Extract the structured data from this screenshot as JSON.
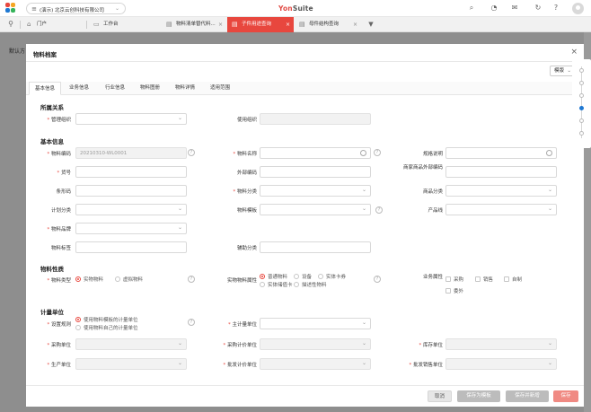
{
  "topbar": {
    "org": "(演示) 北京云创科技有限公司",
    "brand_a": "Yon",
    "brand_b": "Suite"
  },
  "tabs": [
    {
      "label": "门户"
    },
    {
      "label": "工作台"
    },
    {
      "label": "物料清单替代料..."
    },
    {
      "label": "子件用途查询"
    },
    {
      "label": "母件结构查询"
    }
  ],
  "background": {
    "label": "默认方"
  },
  "modal": {
    "title": "物料档案",
    "template_label": "模版",
    "tabs": [
      "基本信息",
      "业务信息",
      "行业信息",
      "物料图册",
      "物料详情",
      "适用范围"
    ],
    "sections": {
      "ownership": "所属关系",
      "basic": "基本信息",
      "nature": "物料性质",
      "unit": "计量单位"
    },
    "fields": {
      "mgmt_org": "管理组织",
      "use_org": "使用组织",
      "code": "物料编码",
      "code_value": "20210310-WL0001",
      "name": "物料名称",
      "spec": "规格说明",
      "model": "货号",
      "ext_code": "外部编码",
      "merchant_code": "商家商品外部编码",
      "barcode": "条形码",
      "category": "物料分类",
      "product_category": "商品分类",
      "plan_category": "计划分类",
      "material_template": "物料模板",
      "product_line": "产品线",
      "brand": "物料品牌",
      "tag": "物料标签",
      "aux_category": "辅助分类",
      "material_type": "物料类型",
      "physical_attr": "实物物料属性",
      "business_attr": "业务属性",
      "setting_rule": "设置规则",
      "main_unit": "主计量单位",
      "purchase_unit": "采购单位",
      "purchase_price_unit": "采购计价单位",
      "stock_unit": "库存单位",
      "production_unit": "生产单位",
      "wholesale_price_unit": "批发计价单位",
      "wholesale_sale_unit": "批发销售单位"
    },
    "material_type_options": [
      "实物物料",
      "虚拟物料"
    ],
    "physical_options": [
      "普通物料",
      "设备",
      "实体卡券",
      "实体储值卡",
      "描述性物料"
    ],
    "business_options": [
      "采购",
      "销售",
      "自制",
      "委外"
    ],
    "rule_options": [
      "使用物料模板的计量单位",
      "使用物料自己的计量单位"
    ],
    "footer": {
      "cancel": "取消",
      "save_template": "保存为模板",
      "save_new": "保存并新增",
      "save": "保存"
    }
  },
  "colors": {
    "accent": "#e8473e"
  }
}
